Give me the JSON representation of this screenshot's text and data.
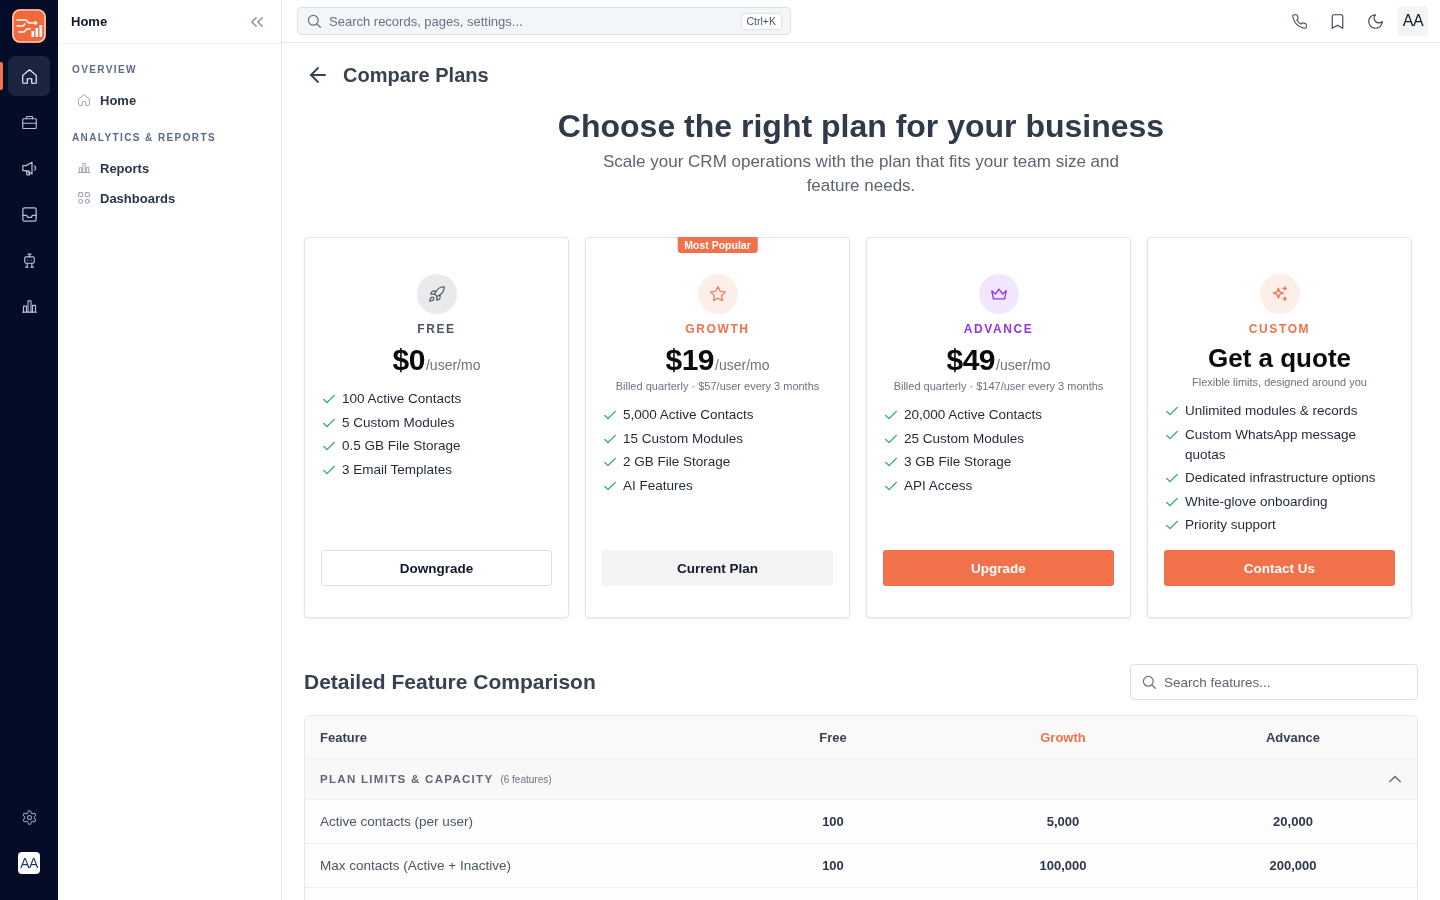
{
  "rail": {
    "items": [
      {
        "selected": true
      },
      {
        "selected": false
      },
      {
        "selected": false
      },
      {
        "selected": false
      },
      {
        "selected": false
      },
      {
        "selected": false
      }
    ],
    "avatar": "AA"
  },
  "sidebar": {
    "title": "Home",
    "sections": [
      {
        "title": "OVERVIEW",
        "items": [
          {
            "label": "Home"
          }
        ]
      },
      {
        "title": "ANALYTICS & REPORTS",
        "items": [
          {
            "label": "Reports"
          },
          {
            "label": "Dashboards"
          }
        ]
      }
    ]
  },
  "topbar": {
    "search": {
      "placeholder": "Search records, pages, settings...",
      "shortcut": "Ctrl+K"
    },
    "avatar": "AA"
  },
  "page": {
    "title": "Compare Plans",
    "heading": "Choose the right plan for your business",
    "subheading": "Scale your CRM operations with the plan that fits your team size and feature needs."
  },
  "plans": [
    {
      "name": "FREE",
      "color": "#4b5563",
      "price": "$0",
      "unit": "/user/mo",
      "features": [
        "100 Active Contacts",
        "5 Custom Modules",
        "0.5 GB File Storage",
        "3 Email Templates"
      ],
      "button": {
        "label": "Downgrade",
        "kind": "outline"
      }
    },
    {
      "name": "GROWTH",
      "color": "#f0714a",
      "badge": "Most Popular",
      "price": "$19",
      "unit": "/user/mo",
      "note": "Billed quarterly · $57/user every 3 months",
      "features": [
        "5,000 Active Contacts",
        "15 Custom Modules",
        "2 GB File Storage",
        "AI Features"
      ],
      "button": {
        "label": "Current Plan",
        "kind": "muted"
      }
    },
    {
      "name": "ADVANCE",
      "color": "#9333ea",
      "price": "$49",
      "unit": "/user/mo",
      "note": "Billed quarterly · $147/user every 3 months",
      "features": [
        "20,000 Active Contacts",
        "25 Custom Modules",
        "3 GB File Storage",
        "API Access"
      ],
      "button": {
        "label": "Upgrade",
        "kind": "primary"
      }
    },
    {
      "name": "CUSTOM",
      "color": "#f0714a",
      "price": "Get a quote",
      "note": "Flexible limits, designed around you",
      "features": [
        "Unlimited modules & records",
        "Custom WhatsApp message quotas",
        "Dedicated infrastructure options",
        "White-glove onboarding",
        "Priority support"
      ],
      "button": {
        "label": "Contact Us",
        "kind": "primary"
      }
    }
  ],
  "comparison": {
    "title": "Detailed Feature Comparison",
    "search": {
      "placeholder": "Search features..."
    },
    "columns": [
      {
        "label": "Feature",
        "highlighted": false
      },
      {
        "label": "Free",
        "highlighted": false
      },
      {
        "label": "Growth",
        "highlighted": true
      },
      {
        "label": "Advance",
        "highlighted": false
      }
    ],
    "sections": [
      {
        "title": "PLAN LIMITS & CAPACITY",
        "count": "(6 features)",
        "expanded": true,
        "rows": [
          {
            "cells": [
              "Active contacts (per user)",
              "100",
              "5,000",
              "20,000"
            ]
          },
          {
            "cells": [
              "Max contacts (Active + Inactive)",
              "100",
              "100,000",
              "200,000"
            ]
          }
        ]
      }
    ]
  }
}
